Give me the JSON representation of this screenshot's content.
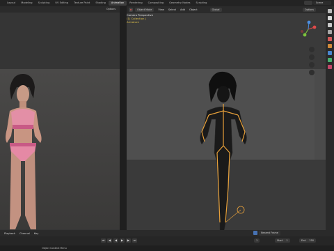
{
  "workspace_tabs": [
    "Layout",
    "Modeling",
    "Sculpting",
    "UV Editing",
    "Texture Paint",
    "Shading",
    "Animation",
    "Rendering",
    "Compositing",
    "Geometry Nodes",
    "Scripting"
  ],
  "active_tab": "Animation",
  "scene_name": "Scene",
  "left_viewport": {
    "options_label": "Options"
  },
  "right_viewport": {
    "mode": "Object Mode",
    "menus": [
      "View",
      "Select",
      "Add",
      "Object"
    ],
    "orientation": "Global",
    "options_label": "Options",
    "annotation_line1": "Camera Perspective",
    "annotation_line2": "(1) Collection | Armature"
  },
  "timeline": {
    "menus": [
      "Playback",
      "Channel",
      "Key"
    ],
    "keying": "Nearest Frame",
    "current_frame": "1",
    "start_label": "Start",
    "start": "1",
    "end_label": "End",
    "end": "250"
  },
  "status": {
    "text": "Object Context Menu"
  },
  "colors": {
    "accent": "#4772b3",
    "armature": "#e8a13a"
  }
}
